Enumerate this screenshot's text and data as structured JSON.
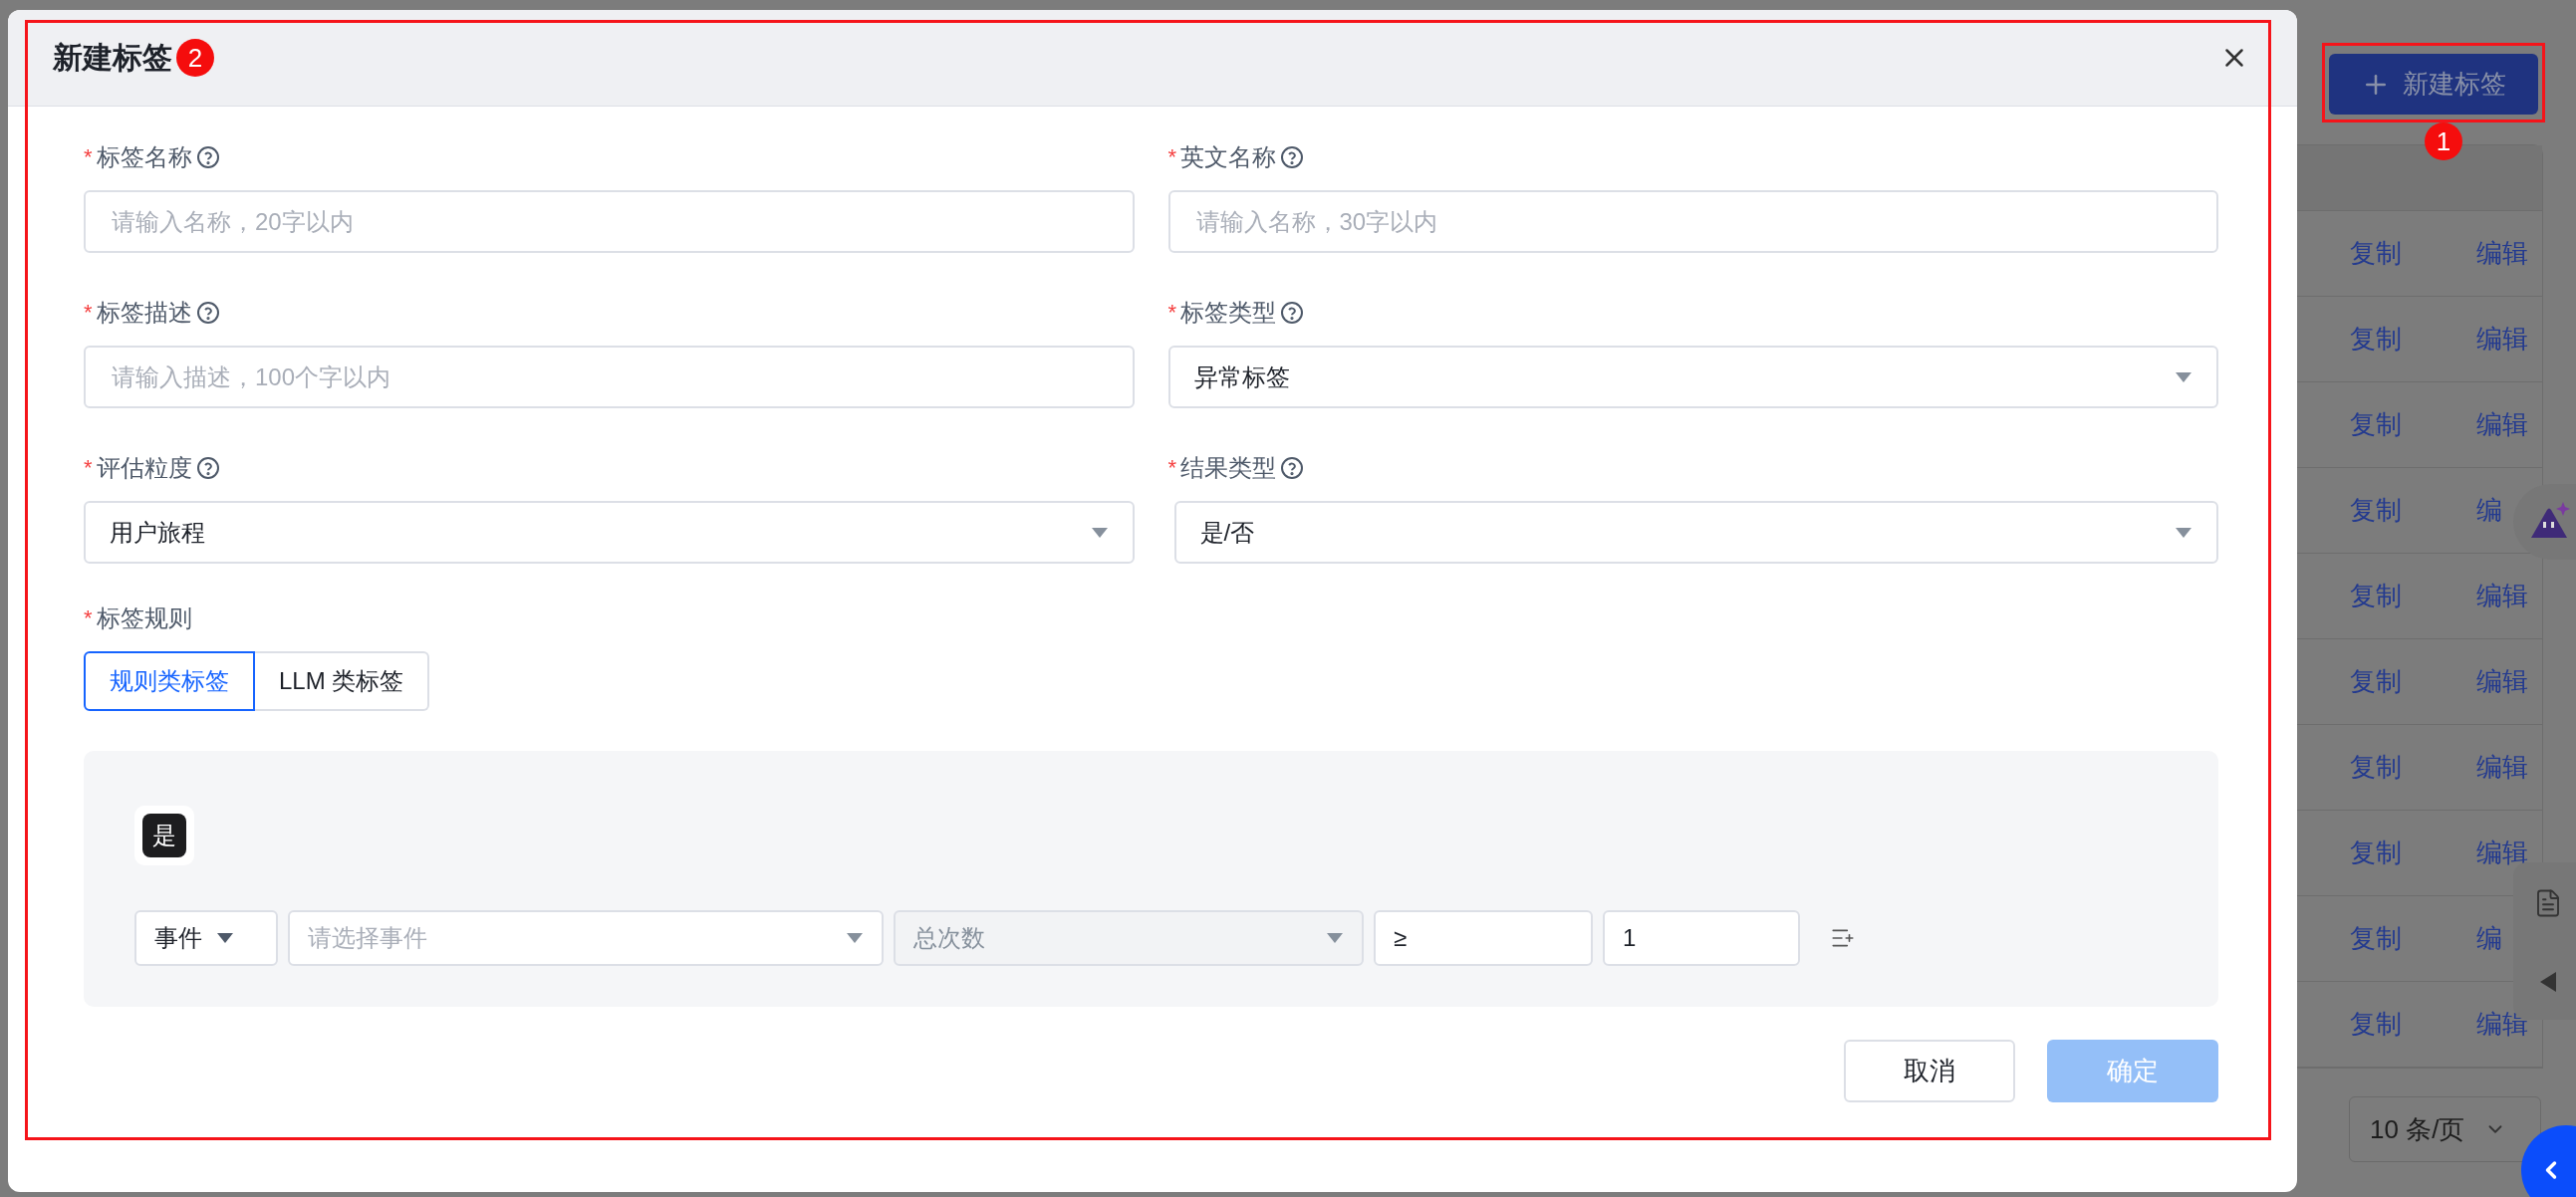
{
  "modal": {
    "title": "新建标签",
    "step_badge": "2",
    "fields": [
      {
        "kind": "input",
        "mark": "*",
        "label": "标签名称",
        "placeholder": "请输入名称，20字以内"
      },
      {
        "kind": "input",
        "mark": "*",
        "label": "英文名称",
        "placeholder": "请输入名称，30字以内"
      },
      {
        "kind": "input",
        "mark": "*",
        "label": "标签描述",
        "placeholder": "请输入描述，100个字以内"
      },
      {
        "kind": "select",
        "mark": "*",
        "label": "标签类型",
        "value": "异常标签"
      },
      {
        "kind": "select",
        "mark": "*",
        "label": "评估粒度",
        "value": "用户旅程"
      },
      {
        "kind": "select",
        "mark": "*",
        "label": "结果类型",
        "value": "是/否"
      }
    ],
    "rule": {
      "mark": "*",
      "label": "标签规则",
      "modes": [
        {
          "label": "规则类标签",
          "selected": true
        },
        {
          "label": "LLM 类标签",
          "selected": false
        }
      ],
      "branch_tag": "是",
      "condition": [
        {
          "kind": "select",
          "value": "事件",
          "disabled": false
        },
        {
          "kind": "select",
          "placeholder": "请选择事件",
          "disabled": false
        },
        {
          "kind": "select",
          "value": "总次数",
          "disabled": true
        },
        {
          "kind": "input",
          "value": "≥"
        },
        {
          "kind": "input",
          "value": "1"
        }
      ]
    },
    "buttons": [
      {
        "kind": "default",
        "label": "取消"
      },
      {
        "kind": "primary",
        "label": "确定",
        "disabled": true
      }
    ]
  },
  "background": {
    "create_button": "新建标签",
    "step_badge": "1",
    "rows": [
      {
        "action_1": "复制",
        "action_2": "编辑"
      },
      {
        "action_1": "复制",
        "action_2": "编辑"
      },
      {
        "action_1": "复制",
        "action_2": "编辑"
      },
      {
        "action_1": "复制",
        "action_2": "编"
      },
      {
        "action_1": "复制",
        "action_2": "编辑"
      },
      {
        "action_1": "复制",
        "action_2": "编辑"
      },
      {
        "action_1": "复制",
        "action_2": "编辑"
      },
      {
        "action_1": "复制",
        "action_2": "编辑"
      },
      {
        "action_1": "复制",
        "action_2": "编"
      },
      {
        "action_1": "复制",
        "action_2": "编辑"
      }
    ],
    "page_size": "10 条/页"
  }
}
